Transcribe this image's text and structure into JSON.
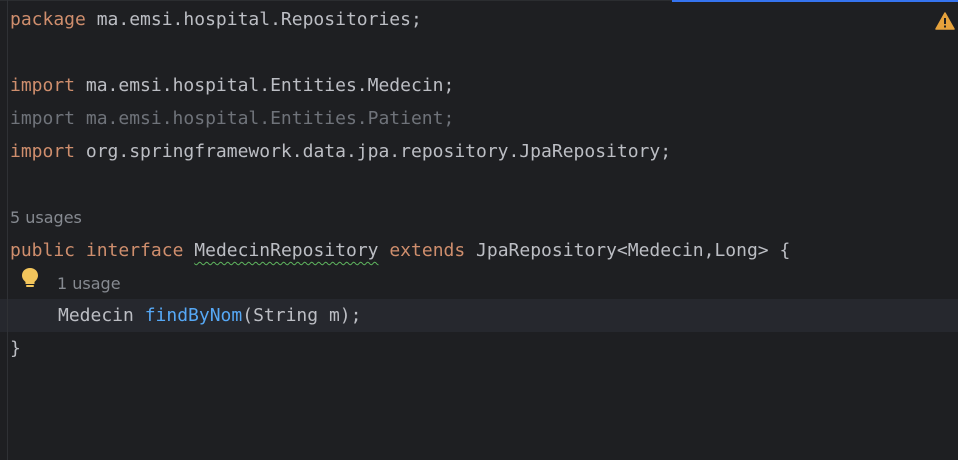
{
  "code": {
    "line1": {
      "keyword": "package",
      "rest": " ma.emsi.hospital.Repositories;"
    },
    "line3": {
      "keyword": "import",
      "rest": " ma.emsi.hospital.Entities.Medecin;"
    },
    "line4": {
      "text": "import ma.emsi.hospital.Entities.Patient;"
    },
    "line5": {
      "keyword": "import",
      "rest": " org.springframework.data.jpa.repository.JpaRepository;"
    },
    "usages_interface": "5 usages",
    "line7": {
      "kw_public": "public",
      "kw_interface": "interface",
      "class_name": "MedecinRepository",
      "kw_extends": "extends",
      "rest": " JpaRepository<Medecin,Long> {"
    },
    "usages_method": "1 usage",
    "line8": {
      "type": "Medecin",
      "method": "findByNom",
      "params": "(String m);"
    },
    "line9": {
      "text": "}"
    }
  },
  "icons": {
    "warning": "warning-triangle-icon",
    "bulb": "lightbulb-icon"
  },
  "colors": {
    "background": "#1e1f22",
    "keyword": "#cf8e6d",
    "text": "#bcbec4",
    "method": "#56a8f5",
    "dimmed": "#6f737a",
    "warning": "#e6a23c"
  }
}
